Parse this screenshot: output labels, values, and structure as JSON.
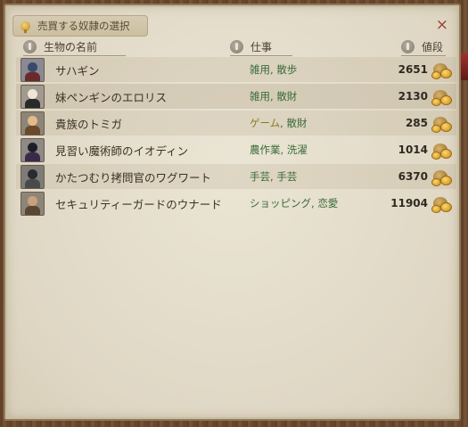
{
  "window": {
    "title": "売買する奴隷の選択",
    "close_symbol": "×"
  },
  "columns": {
    "name": "生物の名前",
    "job": "仕事",
    "price": "値段"
  },
  "rows": [
    {
      "name": "サハギン",
      "job1": "雑用",
      "job2": "散歩",
      "price": "2651",
      "portrait": {
        "head": "#3a4a6a",
        "body": "#6a2a2a",
        "bg": "#8a8a95"
      }
    },
    {
      "name": "妹ペンギンのエロリス",
      "job1": "雑用",
      "job2": "散財",
      "price": "2130",
      "portrait": {
        "head": "#f0e6d6",
        "body": "#2a2a2a",
        "bg": "#a09a90"
      }
    },
    {
      "name": "貴族のトミガ",
      "job1": "ゲーム",
      "job2": "散財",
      "price": "285",
      "portrait": {
        "head": "#e6b98a",
        "body": "#6a4a2a",
        "bg": "#8d8678"
      }
    },
    {
      "name": "見習い魔術師のイオディン",
      "job1": "農作業",
      "job2": "洗濯",
      "price": "1014",
      "portrait": {
        "head": "#1e1e2a",
        "body": "#3a2a4a",
        "bg": "#8e8a84"
      }
    },
    {
      "name": "かたつむり拷問官のワグワート",
      "job1": "手芸",
      "job2": "手芸",
      "price": "6370",
      "portrait": {
        "head": "#2a2a30",
        "body": "#4a4a4a",
        "bg": "#7e7c78"
      }
    },
    {
      "name": "セキュリティーガードのウナード",
      "job1": "ショッピング",
      "job2": "恋愛",
      "price": "11904",
      "portrait": {
        "head": "#c9a27a",
        "body": "#5a4632",
        "bg": "#8d8678"
      }
    }
  ],
  "icons": {
    "title": "lightbulb-icon",
    "sort": "sort-icon",
    "currency": "gold-coin-bag-icon"
  },
  "colors": {
    "job_text": "#3a6a3a",
    "job_highlight": "#8a7a1a",
    "close": "#9a4237",
    "panel": "#e4ddcb"
  }
}
